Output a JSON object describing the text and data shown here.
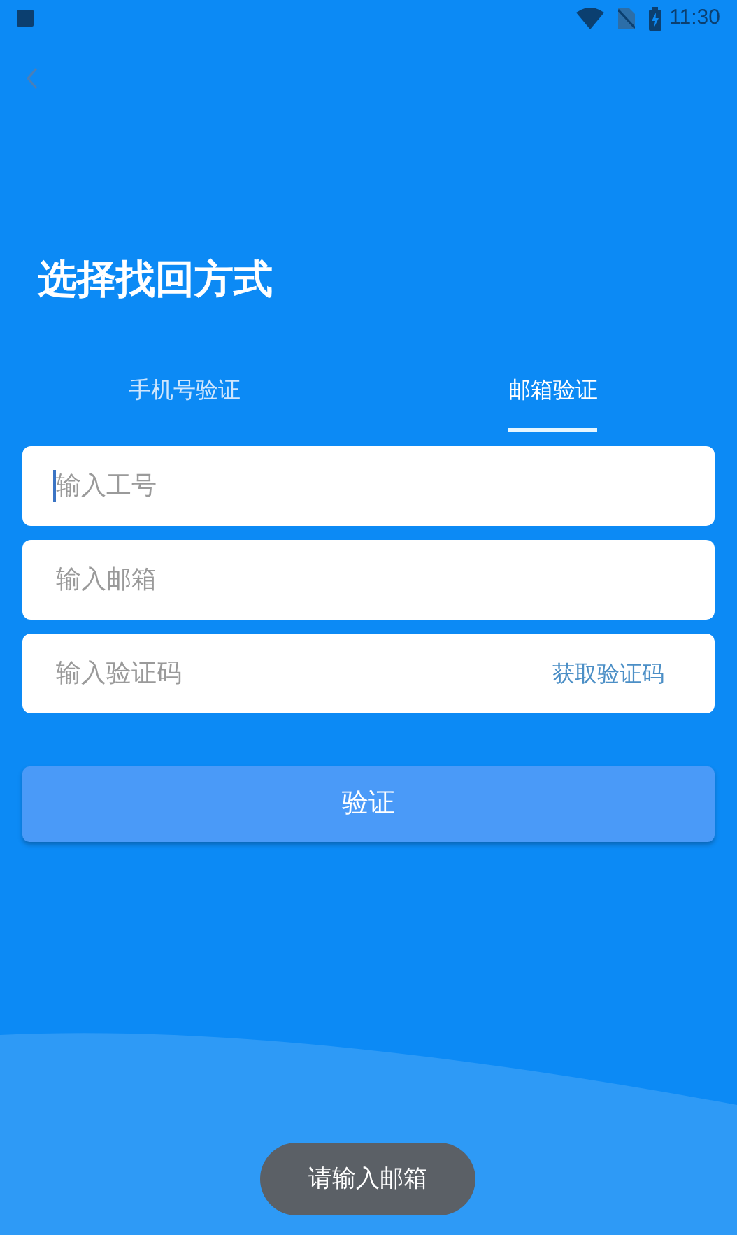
{
  "status_bar": {
    "time": "11:30"
  },
  "title": "选择找回方式",
  "tabs": [
    {
      "label": "手机号验证",
      "selected": false
    },
    {
      "label": "邮箱验证",
      "selected": true
    }
  ],
  "fields": [
    {
      "placeholder": "输入工号",
      "focused": true
    },
    {
      "placeholder": "输入邮箱",
      "focused": false
    },
    {
      "placeholder": "输入验证码",
      "focused": false,
      "action": "获取验证码"
    }
  ],
  "submit_button": "验证",
  "toast": "请输入邮箱"
}
